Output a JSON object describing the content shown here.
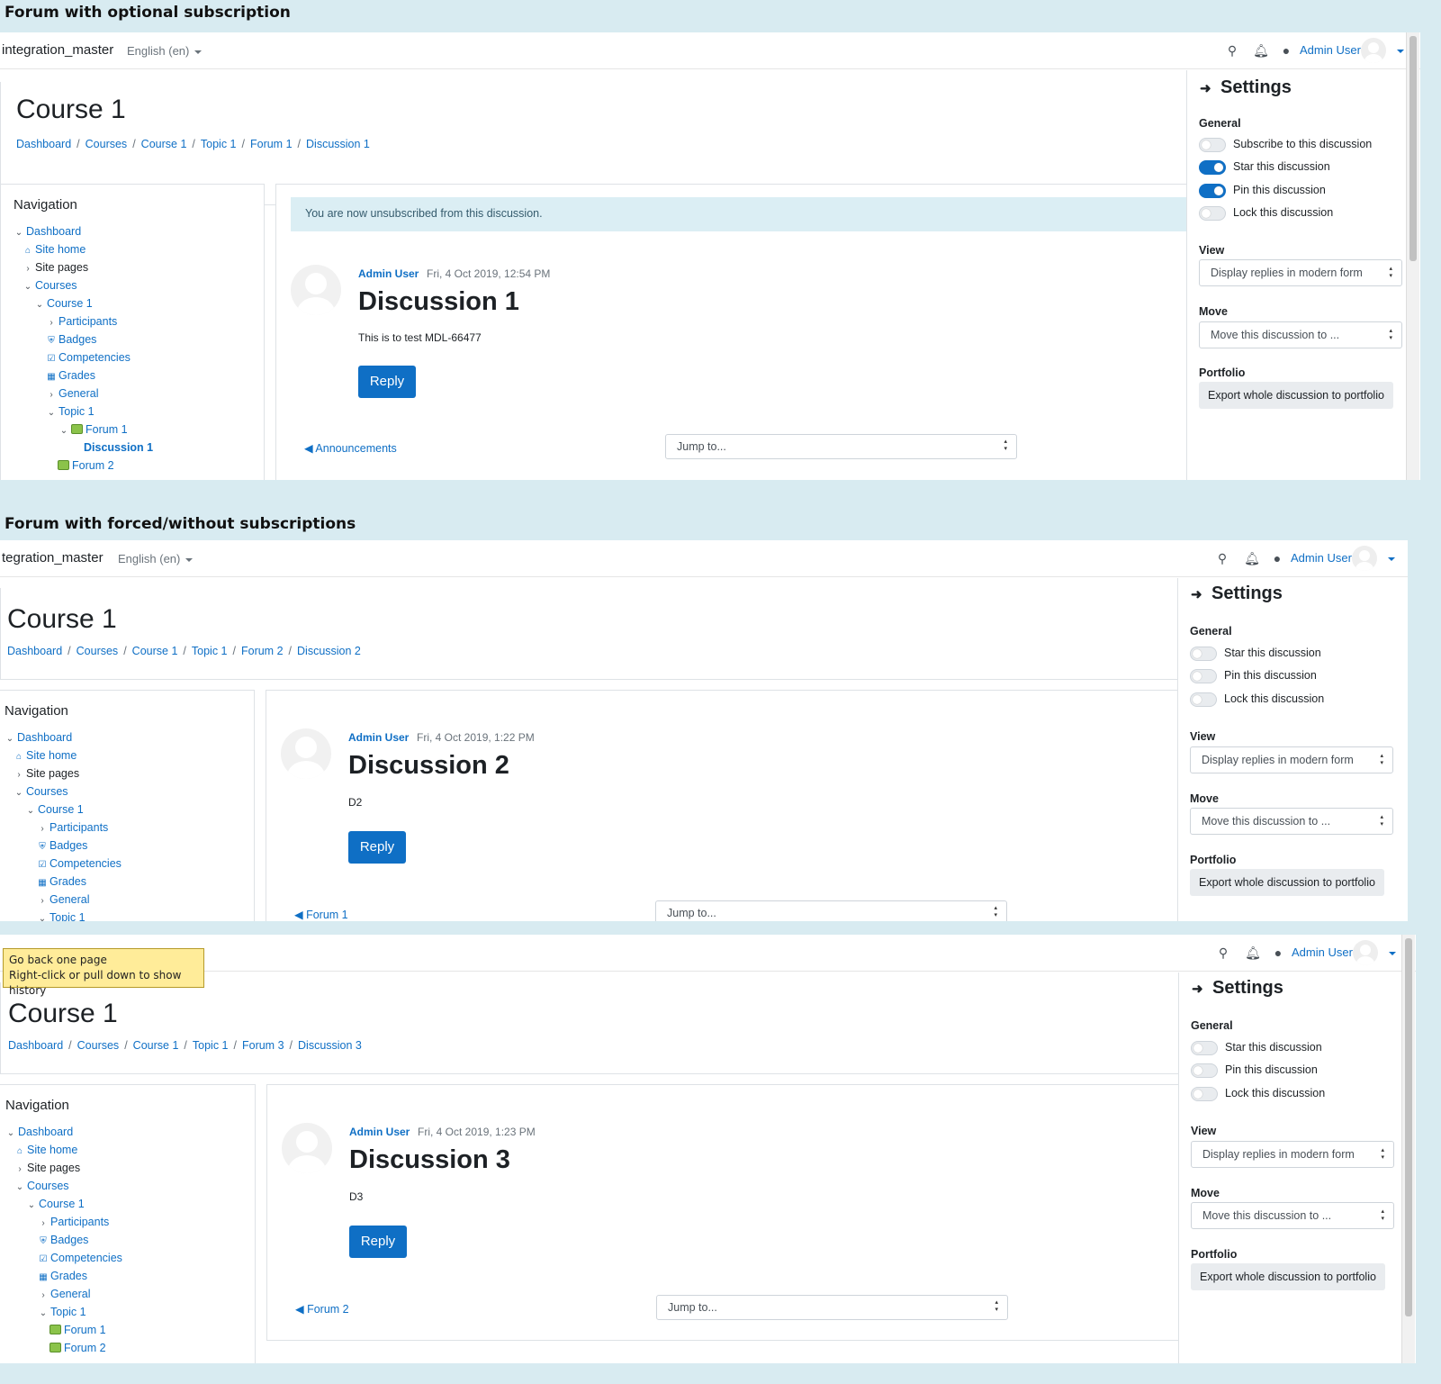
{
  "captions": {
    "optional": "Forum with optional subscription",
    "forced": "Forum with forced/without subscriptions"
  },
  "tooltip": {
    "line1": "Go back one page",
    "line2": "Right-click or pull down to show history"
  },
  "shot1": {
    "site_name": "integration_master",
    "language": "English (en)",
    "user": "Admin User",
    "course_title": "Course 1",
    "breadcrumbs": [
      "Dashboard",
      "Courses",
      "Course 1",
      "Topic 1",
      "Forum 1",
      "Discussion 1"
    ],
    "nav_title": "Navigation",
    "nav_items": [
      "Dashboard",
      "Site home",
      "Site pages",
      "Courses",
      "Course 1",
      "Participants",
      "Badges",
      "Competencies",
      "Grades",
      "General",
      "Topic 1",
      "Forum 1",
      "Discussion 1",
      "Forum 2"
    ],
    "alert": "You are now unsubscribed from this discussion.",
    "author": "Admin User",
    "date": "Fri, 4 Oct 2019, 12:54 PM",
    "discussion_title": "Discussion 1",
    "body": "This is to test MDL-66477",
    "reply": "Reply",
    "prev_link": "Announcements",
    "jump": "Jump to...",
    "settings": {
      "title": "Settings",
      "general": "General",
      "toggles": [
        {
          "label": "Subscribe to this discussion",
          "on": false
        },
        {
          "label": "Star this discussion",
          "on": true
        },
        {
          "label": "Pin this discussion",
          "on": true
        },
        {
          "label": "Lock this discussion",
          "on": false
        }
      ],
      "view": "View",
      "view_value": "Display replies in modern form",
      "move": "Move",
      "move_value": "Move this discussion to ...",
      "portfolio": "Portfolio",
      "export": "Export whole discussion to portfolio"
    }
  },
  "shot2": {
    "site_name": "tegration_master",
    "language": "English (en)",
    "user": "Admin User",
    "course_title": "Course 1",
    "breadcrumbs": [
      "Dashboard",
      "Courses",
      "Course 1",
      "Topic 1",
      "Forum 2",
      "Discussion 2"
    ],
    "nav_title": "Navigation",
    "nav_items": [
      "Dashboard",
      "Site home",
      "Site pages",
      "Courses",
      "Course 1",
      "Participants",
      "Badges",
      "Competencies",
      "Grades",
      "General",
      "Topic 1"
    ],
    "author": "Admin User",
    "date": "Fri, 4 Oct 2019, 1:22 PM",
    "discussion_title": "Discussion 2",
    "body": "D2",
    "reply": "Reply",
    "prev_link": "Forum 1",
    "jump": "Jump to...",
    "settings": {
      "title": "Settings",
      "general": "General",
      "toggles": [
        {
          "label": "Star this discussion",
          "on": false
        },
        {
          "label": "Pin this discussion",
          "on": false
        },
        {
          "label": "Lock this discussion",
          "on": false
        }
      ],
      "view": "View",
      "view_value": "Display replies in modern form",
      "move": "Move",
      "move_value": "Move this discussion to ...",
      "portfolio": "Portfolio",
      "export": "Export whole discussion to portfolio"
    }
  },
  "shot3": {
    "user": "Admin User",
    "course_title": "Course 1",
    "breadcrumbs": [
      "Dashboard",
      "Courses",
      "Course 1",
      "Topic 1",
      "Forum 3",
      "Discussion 3"
    ],
    "nav_title": "Navigation",
    "nav_items": [
      "Dashboard",
      "Site home",
      "Site pages",
      "Courses",
      "Course 1",
      "Participants",
      "Badges",
      "Competencies",
      "Grades",
      "General",
      "Topic 1",
      "Forum 1",
      "Forum 2"
    ],
    "author": "Admin User",
    "date": "Fri, 4 Oct 2019, 1:23 PM",
    "discussion_title": "Discussion 3",
    "body": "D3",
    "reply": "Reply",
    "prev_link": "Forum 2",
    "jump": "Jump to...",
    "settings": {
      "title": "Settings",
      "general": "General",
      "toggles": [
        {
          "label": "Star this discussion",
          "on": false
        },
        {
          "label": "Pin this discussion",
          "on": false
        },
        {
          "label": "Lock this discussion",
          "on": false
        }
      ],
      "view": "View",
      "view_value": "Display replies in modern form",
      "move": "Move",
      "move_value": "Move this discussion to ...",
      "portfolio": "Portfolio",
      "export": "Export whole discussion to portfolio"
    }
  },
  "colors": {
    "link": "#0f6fc5",
    "background": "#d8ebf1",
    "alert": "#dbeef4",
    "tooltip": "#ffec99"
  },
  "icons": [
    "search-icon",
    "bell-icon",
    "chat-icon",
    "home-icon",
    "badge-icon",
    "checkbox-icon",
    "table-icon",
    "forum-icon",
    "chevron-right-icon",
    "chevron-down-icon",
    "arrow-right-icon"
  ]
}
